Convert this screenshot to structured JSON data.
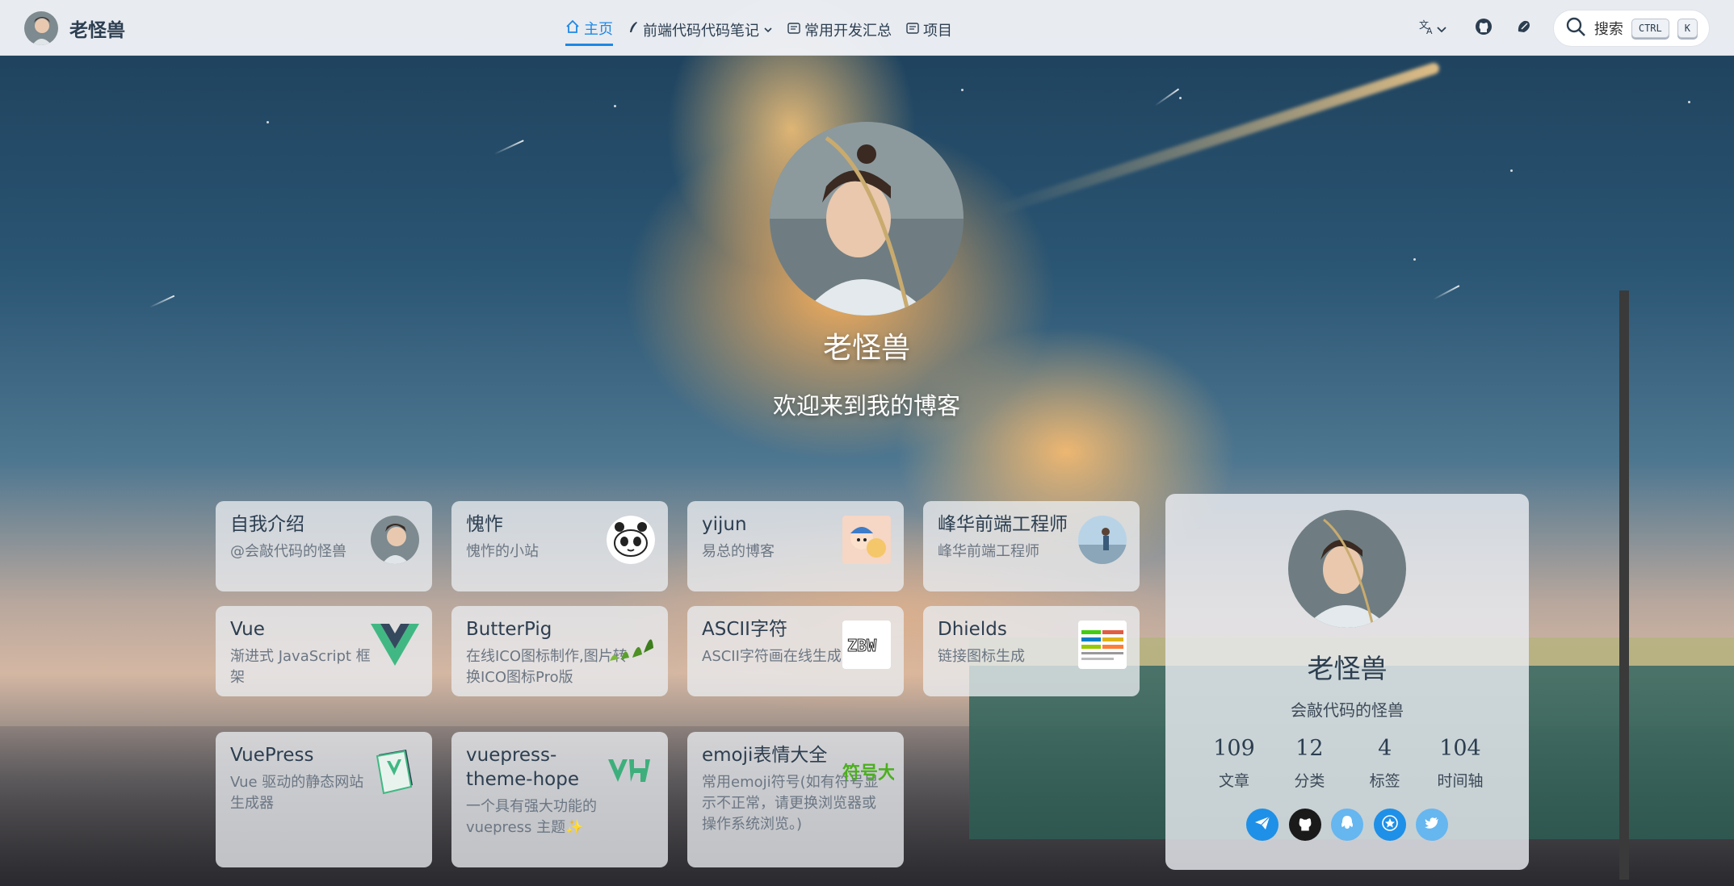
{
  "brand": {
    "name": "老怪兽"
  },
  "nav": {
    "items": [
      {
        "label": "主页",
        "icon": "home-icon",
        "active": true
      },
      {
        "label": "前端代码代码笔记",
        "icon": "pen-icon",
        "dropdown": true
      },
      {
        "label": "常用开发汇总",
        "icon": "note-icon"
      },
      {
        "label": "项目",
        "icon": "note-icon"
      }
    ]
  },
  "search": {
    "label": "搜索",
    "key1": "CTRL",
    "key2": "K"
  },
  "hero": {
    "name": "老怪兽",
    "tagline": "欢迎来到我的博客"
  },
  "cards": [
    {
      "title": "自我介绍",
      "desc": "@会敲代码的怪兽",
      "logo": "avatar"
    },
    {
      "title": "愧怍",
      "desc": "愧怍的小站",
      "logo": "panda"
    },
    {
      "title": "yijun",
      "desc": "易总的博客",
      "logo": "cartoon"
    },
    {
      "title": "峰华前端工程师",
      "desc": "峰华前端工程师",
      "logo": "person"
    },
    {
      "title": "Vue",
      "desc": "渐进式 JavaScript 框架",
      "logo": "vue"
    },
    {
      "title": "ButterPig",
      "desc": "在线ICO图标制作,图片转换ICO图标Pro版",
      "logo": "leaves"
    },
    {
      "title": "ASCII字符",
      "desc": "ASCII字符画在线生成",
      "logo": "ascii"
    },
    {
      "title": "Dhields",
      "desc": "链接图标生成",
      "logo": "badges"
    },
    {
      "title": "VuePress",
      "desc": "Vue 驱动的静态网站生成器",
      "logo": "vuepress"
    },
    {
      "title": "vuepress-theme-hope",
      "desc": "一个具有强大功能的 vuepress 主题✨",
      "logo": "vh"
    },
    {
      "title": "emoji表情大全",
      "desc": "常用emoji符号(如有符号显示不正常，请更换浏览器或操作系统浏览。)",
      "logo": "fuhao",
      "logo_text": "符号大全"
    }
  ],
  "profile": {
    "name": "老怪兽",
    "desc": "会敲代码的怪兽",
    "stats": [
      {
        "num": "109",
        "label": "文章"
      },
      {
        "num": "12",
        "label": "分类"
      },
      {
        "num": "4",
        "label": "标签"
      },
      {
        "num": "104",
        "label": "时间轴"
      }
    ],
    "socials": [
      "paper-plane-icon",
      "github-icon",
      "qq-icon",
      "star-icon",
      "twitter-icon"
    ]
  },
  "colors": {
    "accent": "#1e88e5",
    "vue_green": "#41b883"
  }
}
